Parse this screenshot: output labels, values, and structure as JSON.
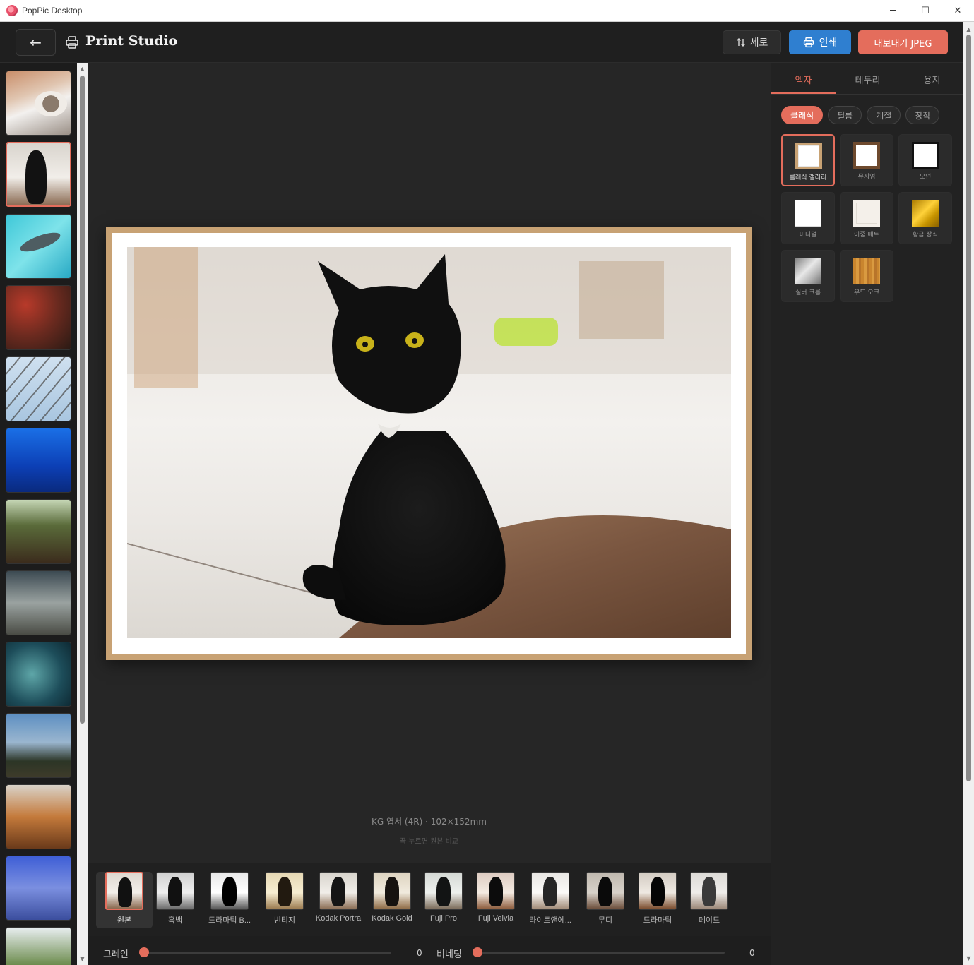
{
  "window": {
    "title": "PopPic Desktop",
    "minimize": "─",
    "maximize": "☐",
    "close": "✕"
  },
  "header": {
    "back_icon": "←",
    "title": "Print Studio",
    "orientation_label": "세로",
    "print_label": "인쇄",
    "export_label": "내보내기 JPEG"
  },
  "canvas": {
    "paper_info": "KG 엽서 (4R) · 102×152mm",
    "hint": "꾹 누르면 원본 비교"
  },
  "filters": [
    {
      "label": "원본",
      "selected": true
    },
    {
      "label": "흑백"
    },
    {
      "label": "드라마틱 B..."
    },
    {
      "label": "빈티지"
    },
    {
      "label": "Kodak Portra"
    },
    {
      "label": "Kodak Gold"
    },
    {
      "label": "Fuji Pro"
    },
    {
      "label": "Fuji Velvia"
    },
    {
      "label": "라이트앤에..."
    },
    {
      "label": "무디"
    },
    {
      "label": "드라마틱"
    },
    {
      "label": "페이드"
    }
  ],
  "sliders": {
    "grain_label": "그레인",
    "grain_value": "0",
    "vignette_label": "비네팅",
    "vignette_value": "0"
  },
  "right_panel": {
    "tabs": [
      "액자",
      "테두리",
      "용지"
    ],
    "active_tab": 0,
    "chips": [
      "클래식",
      "필름",
      "계절",
      "창작"
    ],
    "active_chip": 0,
    "frames": [
      {
        "label": "클래식 갤러리",
        "selected": true
      },
      {
        "label": "뮤지엄"
      },
      {
        "label": "모던"
      },
      {
        "label": "미니멀"
      },
      {
        "label": "이중 매트"
      },
      {
        "label": "황금 장식"
      },
      {
        "label": "실버 크롬"
      },
      {
        "label": "우드 오크"
      }
    ]
  },
  "colors": {
    "accent": "#e46d5c",
    "print_blue": "#2f7fd0",
    "frame_wood": "#c8a274"
  }
}
